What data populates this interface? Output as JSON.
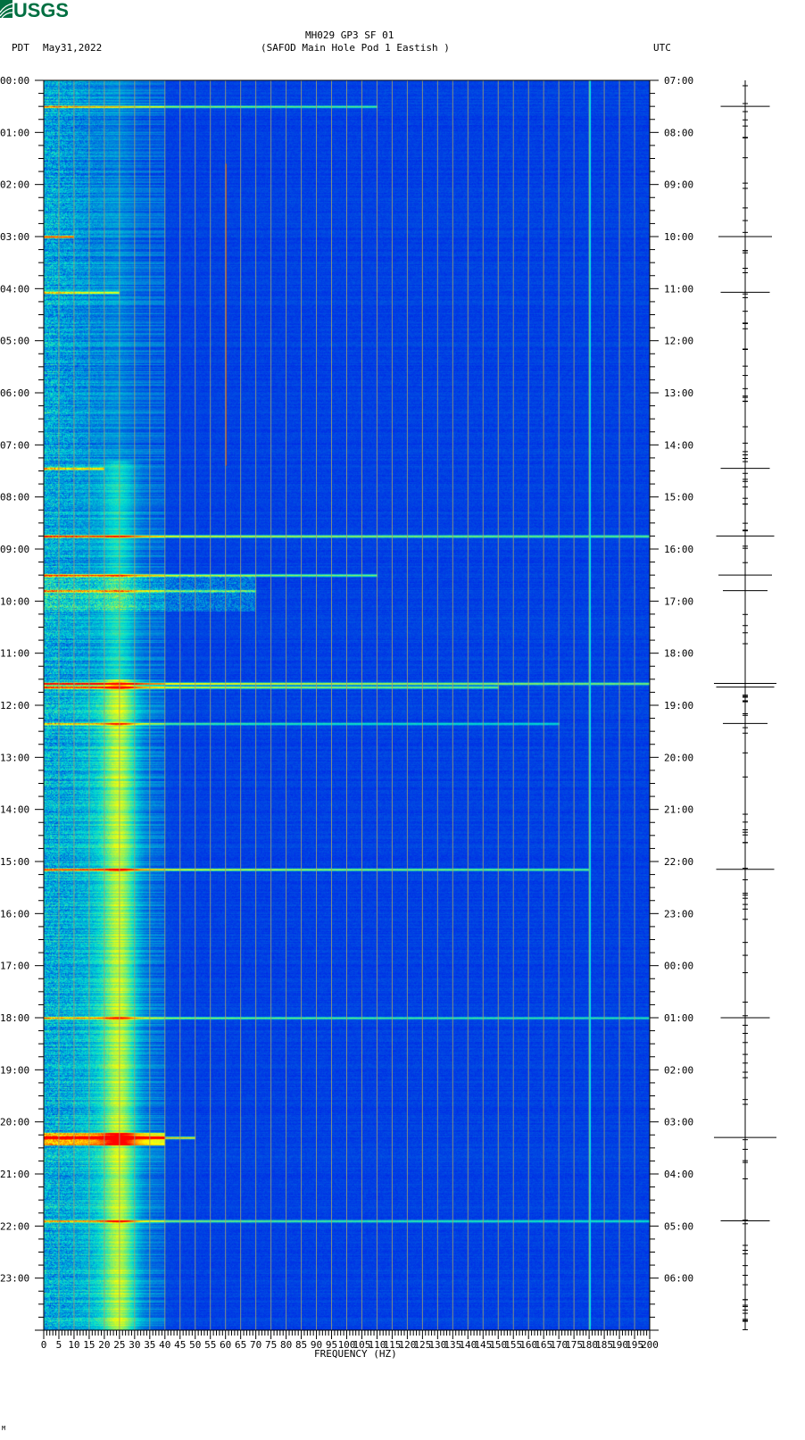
{
  "header": {
    "logo_text": "USGS",
    "title": "MH029 GP3 SF 01",
    "subtitle": "(SAFOD Main Hole Pod 1 Eastish )",
    "left_tz": "PDT",
    "date": "May31,2022",
    "right_tz": "UTC"
  },
  "footer_mark": "M",
  "colors": {
    "background": "#0000e6",
    "gridline": "#a0a070",
    "logo": "#006f41",
    "hot": "#ff0000",
    "mid": "#ffff00",
    "cool": "#00ffff"
  },
  "chart_data": {
    "type": "heatmap",
    "title": "MH029 GP3 SF 01",
    "xlabel": "FREQUENCY (HZ)",
    "xlim": [
      0,
      200
    ],
    "x_ticks": [
      "0",
      "5",
      "10",
      "15",
      "20",
      "25",
      "30",
      "35",
      "40",
      "45",
      "50",
      "55",
      "60",
      "65",
      "70",
      "75",
      "80",
      "85",
      "90",
      "95",
      "100",
      "105",
      "110",
      "115",
      "120",
      "125",
      "130",
      "135",
      "140",
      "145",
      "150",
      "155",
      "160",
      "165",
      "170",
      "175",
      "180",
      "185",
      "190",
      "195",
      "200"
    ],
    "y_left_ticks": [
      "00:00",
      "01:00",
      "02:00",
      "03:00",
      "04:00",
      "05:00",
      "06:00",
      "07:00",
      "08:00",
      "09:00",
      "10:00",
      "11:00",
      "12:00",
      "13:00",
      "14:00",
      "15:00",
      "16:00",
      "17:00",
      "18:00",
      "19:00",
      "20:00",
      "21:00",
      "22:00",
      "23:00"
    ],
    "y_right_ticks": [
      "07:00",
      "08:00",
      "09:00",
      "10:00",
      "11:00",
      "12:00",
      "13:00",
      "14:00",
      "15:00",
      "16:00",
      "17:00",
      "18:00",
      "19:00",
      "20:00",
      "21:00",
      "22:00",
      "23:00",
      "00:00",
      "01:00",
      "02:00",
      "03:00",
      "04:00",
      "05:00",
      "06:00"
    ],
    "ylim_hours": [
      0,
      24
    ],
    "grid": true,
    "persistent_lines_hz": [
      {
        "freq": 25,
        "note": "strong band 20-30 Hz, strongest after 12:00"
      },
      {
        "freq": 60,
        "intermittent": true
      },
      {
        "freq": 180,
        "color": "cyan"
      }
    ],
    "events_pdt_hours": [
      {
        "t": 0.5,
        "fmax": 110,
        "strength": 0.7
      },
      {
        "t": 3.0,
        "fmax": 10,
        "strength": 0.8
      },
      {
        "t": 4.07,
        "fmax": 25,
        "strength": 0.7
      },
      {
        "t": 7.45,
        "fmax": 20,
        "strength": 0.7
      },
      {
        "t": 8.75,
        "fmax": 200,
        "strength": 0.9
      },
      {
        "t": 9.5,
        "fmax": 110,
        "strength": 0.8
      },
      {
        "t": 9.8,
        "fmax": 70,
        "strength": 0.6
      },
      {
        "t": 11.58,
        "fmax": 200,
        "strength": 1.0
      },
      {
        "t": 11.65,
        "fmax": 150,
        "strength": 0.9
      },
      {
        "t": 12.35,
        "fmax": 170,
        "strength": 0.6
      },
      {
        "t": 15.15,
        "fmax": 180,
        "strength": 0.9
      },
      {
        "t": 18.0,
        "fmax": 200,
        "strength": 0.7
      },
      {
        "t": 20.3,
        "fmax": 50,
        "strength": 1.0
      },
      {
        "t": 21.9,
        "fmax": 200,
        "strength": 0.7
      }
    ]
  }
}
